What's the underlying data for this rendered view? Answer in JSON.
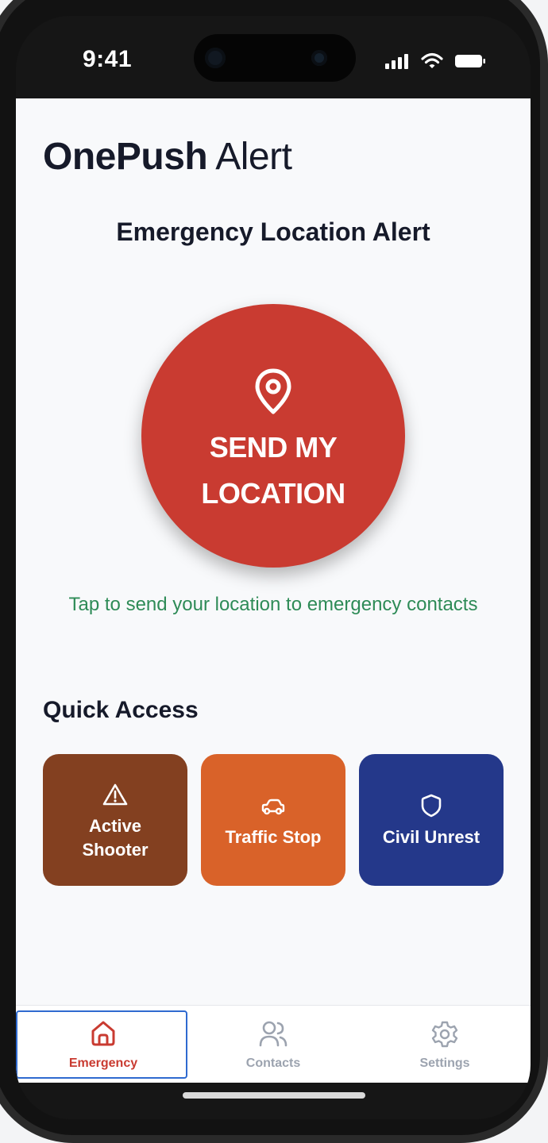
{
  "status_bar": {
    "time": "9:41",
    "icons": [
      "signal-icon",
      "wifi-icon",
      "battery-icon"
    ]
  },
  "app": {
    "brand_bold": "OnePush",
    "brand_light": "Alert",
    "page_title": "Emergency Location Alert",
    "send_button": {
      "line1": "SEND MY",
      "line2": "LOCATION",
      "icon": "map-pin-icon",
      "color": "#c93b31"
    },
    "hint": "Tap to send your location to emergency contacts",
    "hint_color": "#2e8b57",
    "quick_access": {
      "title": "Quick Access",
      "tiles": [
        {
          "line1": "Active",
          "line2": "Shooter",
          "icon": "warning-triangle-icon",
          "color": "#834020"
        },
        {
          "label": "Traffic Stop",
          "icon": "car-icon",
          "color": "#d96229"
        },
        {
          "label": "Civil Unrest",
          "icon": "shield-icon",
          "color": "#24388a"
        }
      ]
    }
  },
  "tabbar": {
    "tabs": [
      {
        "label": "Emergency",
        "icon": "home-icon",
        "active": true
      },
      {
        "label": "Contacts",
        "icon": "users-icon",
        "active": false
      },
      {
        "label": "Settings",
        "icon": "gear-icon",
        "active": false
      }
    ],
    "active_color": "#c93b31",
    "inactive_color": "#9ca3af"
  }
}
